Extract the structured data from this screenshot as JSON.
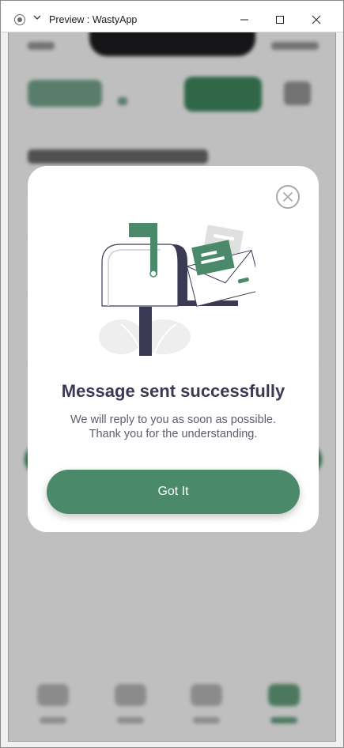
{
  "window": {
    "title": "Preview : WastyApp"
  },
  "modal": {
    "title": "Message sent successfully",
    "message_line1": "We will reply to you as soon as possible.",
    "message_line2": "Thank you for the understanding.",
    "button_label": "Got It",
    "close_icon": "close-icon",
    "illustration": "mailbox-icon"
  },
  "colors": {
    "accent": "#4a8a6b",
    "title_text": "#3b3a55",
    "body_text": "#5d5d6e"
  }
}
